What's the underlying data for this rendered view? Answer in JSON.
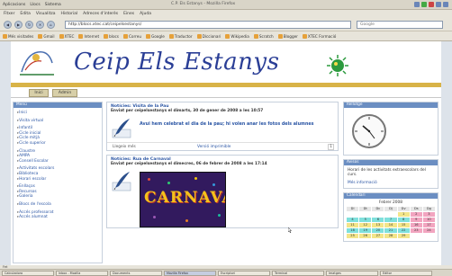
{
  "system": {
    "menu": [
      "Aplicacions",
      "Llocs",
      "Sistema"
    ],
    "window_title": "C.P. Els Estanys - Mozilla Firefox"
  },
  "browser": {
    "menus": [
      "Fitxer",
      "Edita",
      "Visualitza",
      "Historial",
      "Adreces d'interès",
      "Eines",
      "Ajuda"
    ],
    "url": "http://blocs.xtec.cat/ceipelsestanys/",
    "search_placeholder": "Google",
    "bookmarks": [
      "Més visitades",
      "Gmail",
      "XTEC",
      "Internet",
      "blocs",
      "Correu",
      "Google",
      "Traductor",
      "Diccionari",
      "Wikipedia",
      "Scratch",
      "Blogger",
      "XTEC Formació"
    ]
  },
  "site": {
    "title": "Ceip Els Estanys",
    "tabs": [
      "Inici",
      "Admin"
    ],
    "left_block_title": "Menú",
    "left_menu_groups": [
      [
        "Inici"
      ],
      [
        "Visita virtual"
      ],
      [
        "Infantil",
        "Cicle inicial",
        "Cicle mitjà",
        "Cicle superior"
      ],
      [
        "Claustre",
        "AMPA",
        "Consell Escolar"
      ],
      [
        "Activitats escolars",
        "Biblioteca",
        "Horari escolar"
      ],
      [
        "Enllaços",
        "Recursos",
        "Galeria"
      ],
      [
        "Blocs de l'escola"
      ],
      [
        "Accés professorat",
        "Accés alumnat"
      ]
    ],
    "news": [
      {
        "title": "Notícies: Visita de la Pau",
        "meta": "Enviat per ceipelsestanys el dimarts, 30 de gener de 2008 a les 10:57",
        "headline": "Avui hem celebrat el dia de la pau; hi volen anar les fotos dels alumnes",
        "foot_left": "Llegeix més",
        "foot_mid": "Versió imprimible",
        "foot_right": "1"
      },
      {
        "title": "Notícies: Rua de Carnaval",
        "meta": "Enviat per ceipelsestanys el dimecres, 06 de febrer de 2008 a les 17:14",
        "image_text": "CARNAVAL"
      }
    ],
    "right": {
      "clock_title": "Rellotge",
      "ad_title": "Avisos",
      "ad_text": "Horari de les activitats extraescolars del curs.",
      "ad_link": "Més informació",
      "calendar_title": "Calendari",
      "calendar_month": "Febrer 2008",
      "weekdays": [
        "Dl",
        "Dt",
        "Dc",
        "Dj",
        "Dv",
        "Ds",
        "Dg"
      ],
      "days": [
        "",
        "",
        "",
        "",
        "1",
        "2",
        "3",
        "4",
        "5",
        "6",
        "7",
        "8",
        "9",
        "10",
        "11",
        "12",
        "13",
        "14",
        "15",
        "16",
        "17",
        "18",
        "19",
        "20",
        "21",
        "22",
        "23",
        "24",
        "25",
        "26",
        "27",
        "28",
        "29",
        "",
        ""
      ]
    }
  },
  "status": {
    "text": "Fet",
    "tasks": [
      "Calculadora",
      "Inbox - Mozilla",
      "Documents",
      "Mozilla Firefox",
      "Escriptori",
      "Terminal",
      "Imatges",
      "Editor"
    ]
  },
  "colors": {
    "header_stripe": "#d8b347",
    "block_title": "#6b8ec2",
    "link": "#2a55a4",
    "logo": "#2a3e96"
  }
}
